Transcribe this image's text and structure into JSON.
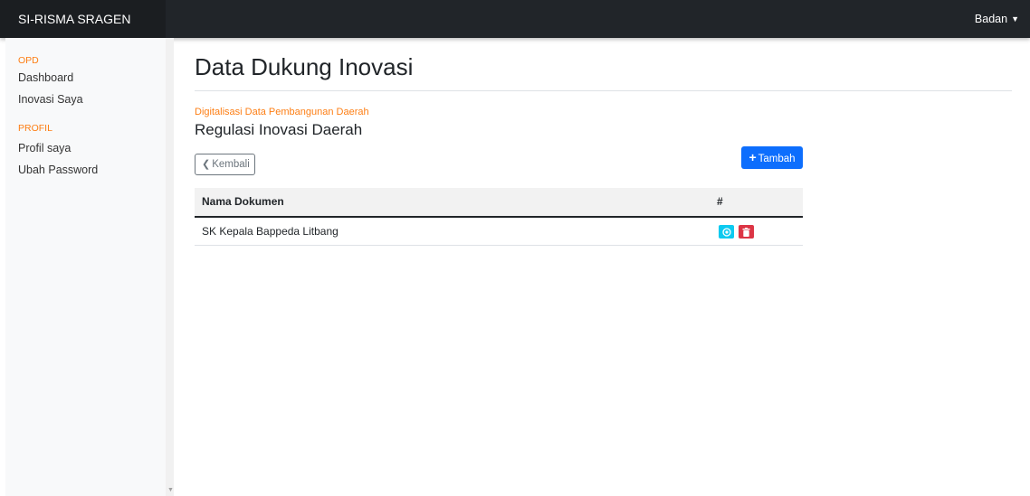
{
  "app": {
    "brand": "SI-RISMA SRAGEN"
  },
  "user_menu": {
    "label": "Badan"
  },
  "sidebar": {
    "sections": [
      {
        "heading": "OPD",
        "items": [
          {
            "label": "Dashboard"
          },
          {
            "label": "Inovasi Saya"
          }
        ]
      },
      {
        "heading": "PROFIL",
        "items": [
          {
            "label": "Profil saya"
          },
          {
            "label": "Ubah Password"
          }
        ]
      }
    ]
  },
  "page": {
    "title": "Data Dukung Inovasi",
    "subtitle": "Digitalisasi Data Pembangunan Daerah",
    "section_title": "Regulasi Inovasi Daerah",
    "back_label": "Kembali",
    "add_label": "Tambah"
  },
  "table": {
    "columns": [
      "Nama Dokumen",
      "#"
    ],
    "rows": [
      {
        "name": "SK Kepala Bappeda Litbang"
      }
    ]
  },
  "colors": {
    "navbar": "#212529",
    "accent_orange": "#fd7e14",
    "primary": "#0d6efd",
    "info": "#0dcaf0",
    "danger": "#dc3545"
  },
  "icons": {
    "back": "chevron-left-icon",
    "add": "plus-icon",
    "view": "eye-icon",
    "delete": "trash-icon",
    "user_caret": "caret-down-icon"
  }
}
